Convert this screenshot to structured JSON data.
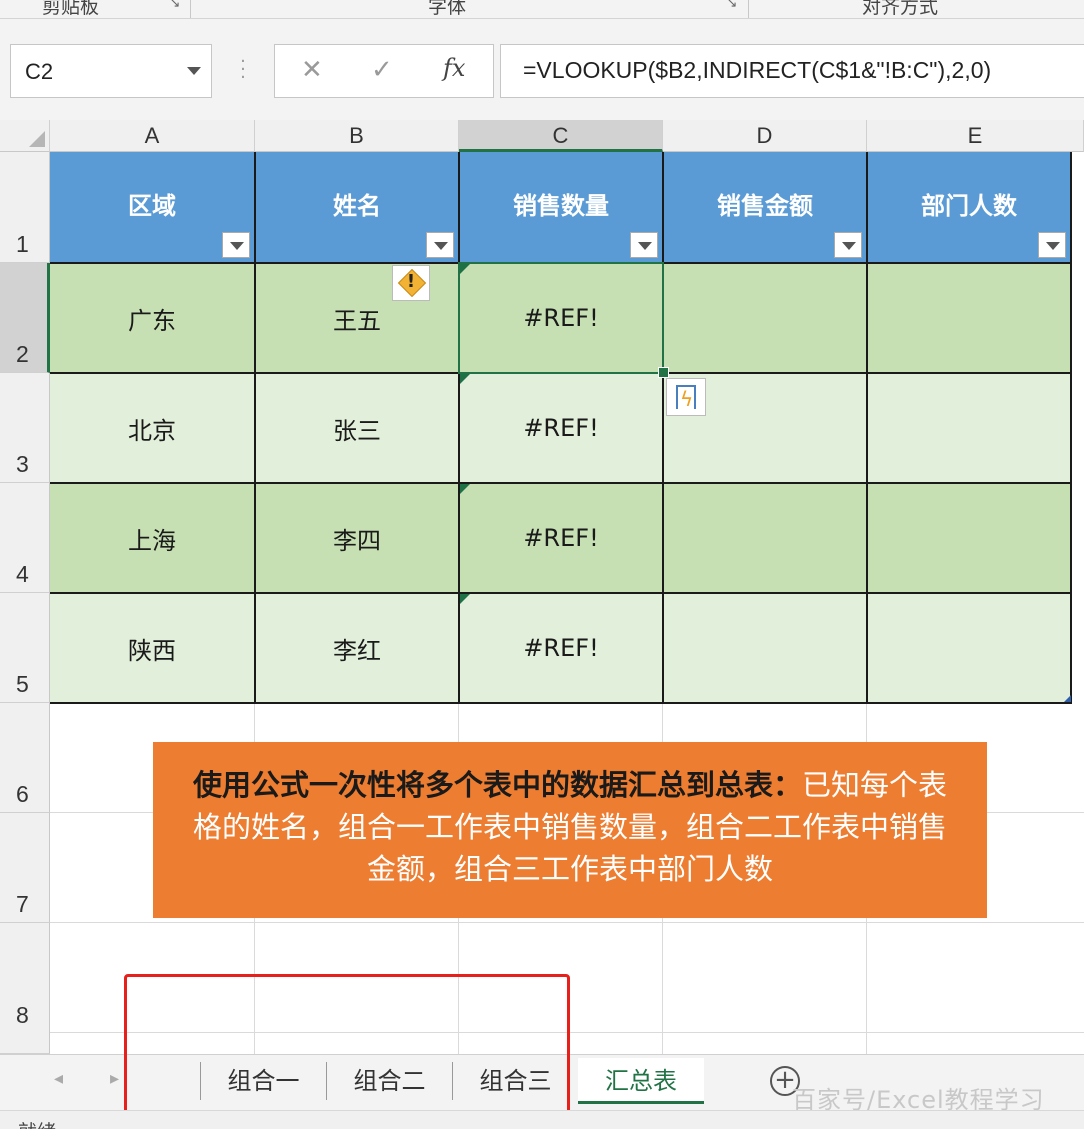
{
  "ribbon": {
    "groups": [
      "剪贴板",
      "字体",
      "对齐方式"
    ]
  },
  "formula_bar": {
    "name_box": "C2",
    "cancel_icon": "✕",
    "enter_icon": "✓",
    "fx_label": "fx",
    "formula": "=VLOOKUP($B2,INDIRECT(C$1&\"!B:C\"),2,0)"
  },
  "columns": [
    "A",
    "B",
    "C",
    "D",
    "E"
  ],
  "selected_column": "C",
  "rows": [
    "1",
    "2",
    "3",
    "4",
    "5",
    "6",
    "7",
    "8"
  ],
  "selected_row": "2",
  "table": {
    "headers": [
      "区域",
      "姓名",
      "销售数量",
      "销售金额",
      "部门人数"
    ],
    "rows": [
      [
        "广东",
        "王五",
        "#REF!",
        "",
        ""
      ],
      [
        "北京",
        "张三",
        "#REF!",
        "",
        ""
      ],
      [
        "上海",
        "李四",
        "#REF!",
        "",
        ""
      ],
      [
        "陕西",
        "李红",
        "#REF!",
        "",
        ""
      ]
    ]
  },
  "callout": {
    "bold_text": "使用公式一次性将多个表中的数据汇总到总表：",
    "text": "已知每个表格的姓名，组合一工作表中销售数量，组合二工作表中销售金额，组合三工作表中部门人数"
  },
  "sheet_tabs": {
    "tabs": [
      "组合一",
      "组合二",
      "组合三",
      "汇总表"
    ],
    "active": "汇总表",
    "add_icon": "⊕"
  },
  "watermark": "百家号/Excel教程学习",
  "status": "就绪",
  "colors": {
    "header_blue": "#5b9bd5",
    "row_dark_green": "#c6e0b4",
    "row_light_green": "#e2efda",
    "callout_orange": "#ed7d31",
    "highlight_red": "#e8201c",
    "excel_green": "#217346"
  },
  "icons": {
    "warning": "warning-icon",
    "flash_fill": "flash-fill-icon",
    "filter": "filter-dropdown-icon"
  }
}
